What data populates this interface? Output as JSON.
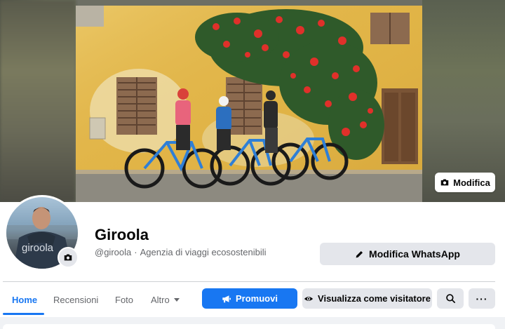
{
  "cover": {
    "edit_label": "Modifica",
    "edit_icon": "camera-icon"
  },
  "profile": {
    "name": "Giroola",
    "handle": "@giroola",
    "separator": "·",
    "category": "Agenzia di viaggi ecosostenibili",
    "avatar_text": "giroola"
  },
  "actions": {
    "whatsapp_label": "Modifica WhatsApp",
    "whatsapp_icon": "pencil-icon"
  },
  "tabs": [
    {
      "label": "Home",
      "active": true
    },
    {
      "label": "Recensioni",
      "active": false
    },
    {
      "label": "Foto",
      "active": false
    },
    {
      "label": "Altro",
      "active": false
    }
  ],
  "toolbar": {
    "promote_label": "Promuovi",
    "visitor_label": "Visualizza come visitatore",
    "more_label": "···"
  },
  "colors": {
    "accent": "#1877f2",
    "button_gray": "#e4e6eb",
    "secondary_text": "#65676b"
  }
}
